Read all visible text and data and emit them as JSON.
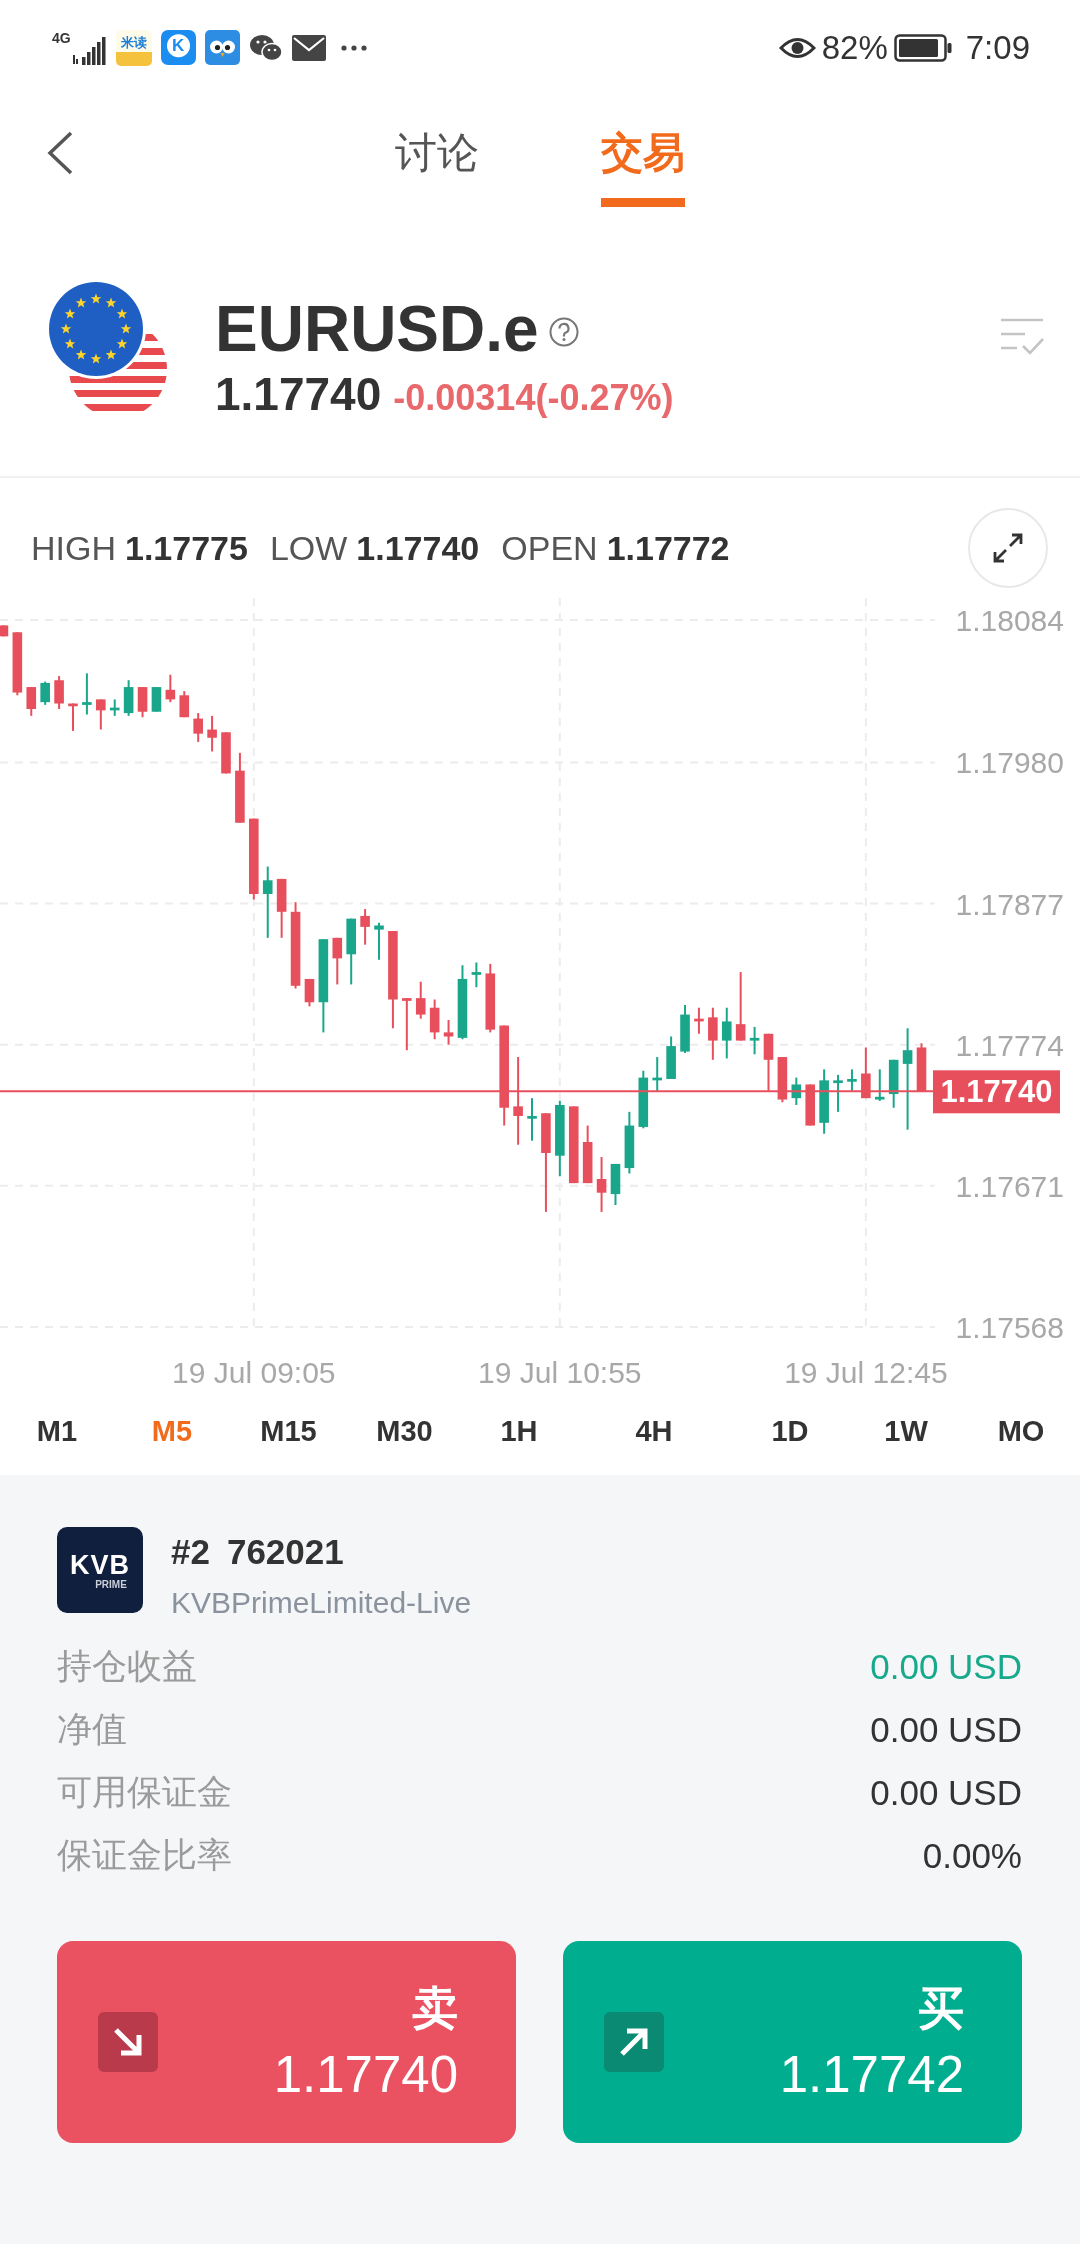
{
  "status_bar": {
    "network": "4G",
    "notifications": [
      {
        "kind": "text_app",
        "label": "米读"
      },
      {
        "kind": "letter_app",
        "label": "K"
      },
      {
        "kind": "owl_app"
      },
      {
        "kind": "chat"
      },
      {
        "kind": "mail"
      }
    ],
    "battery": "82%",
    "time": "7:09"
  },
  "header": {
    "tabs": [
      {
        "label": "讨论",
        "selected": false
      },
      {
        "label": "交易",
        "selected": true
      }
    ]
  },
  "instrument": {
    "symbol": "EURUSD.e",
    "price": "1.17740",
    "change": "-0.00314(-0.27%)"
  },
  "chart": {
    "stats": [
      {
        "label": "HIGH",
        "value": "1.17775"
      },
      {
        "label": "LOW",
        "value": "1.17740"
      },
      {
        "label": "OPEN",
        "value": "1.17772"
      }
    ],
    "chart_data": {
      "type": "candlestick",
      "categories": [
        null,
        null,
        null,
        null,
        null,
        null,
        null,
        null,
        null,
        null,
        null,
        null,
        null,
        null,
        null,
        null,
        null,
        null,
        "19 Jul 09:05",
        null,
        null,
        null,
        null,
        null,
        null,
        null,
        null,
        null,
        null,
        null,
        null,
        null,
        null,
        null,
        null,
        null,
        null,
        null,
        null,
        null,
        "19 Jul 10:55",
        null,
        null,
        null,
        null,
        null,
        null,
        null,
        null,
        null,
        null,
        null,
        null,
        null,
        null,
        null,
        null,
        null,
        null,
        null,
        null,
        null,
        "19 Jul 12:45",
        null,
        null,
        null,
        null
      ],
      "ohlc": [
        [
          1.1808,
          1.1808,
          1.18072,
          1.18072
        ],
        [
          1.18075,
          1.18075,
          1.18029,
          1.18031
        ],
        [
          1.18035,
          1.18035,
          1.18014,
          1.18019
        ],
        [
          1.18024,
          1.18039,
          1.18022,
          1.18038
        ],
        [
          1.1804,
          1.18043,
          1.18019,
          1.18023
        ],
        [
          1.18023,
          1.18023,
          1.18003,
          1.18021
        ],
        [
          1.18022,
          1.18045,
          1.18015,
          1.18024
        ],
        [
          1.18026,
          1.18026,
          1.18004,
          1.18018
        ],
        [
          1.18018,
          1.18026,
          1.18014,
          1.1802
        ],
        [
          1.18016,
          1.1804,
          1.18014,
          1.18035
        ],
        [
          1.18035,
          1.18035,
          1.18013,
          1.18017
        ],
        [
          1.18017,
          1.18035,
          1.18017,
          1.18035
        ],
        [
          1.18033,
          1.18044,
          1.18024,
          1.18026
        ],
        [
          1.18029,
          1.18032,
          1.18013,
          1.18013
        ],
        [
          1.18012,
          1.18016,
          1.17995,
          1.18001
        ],
        [
          1.18004,
          1.18014,
          1.17988,
          1.17998
        ],
        [
          1.18002,
          1.18002,
          1.17972,
          1.17972
        ],
        [
          1.17974,
          1.17987,
          1.17936,
          1.17936
        ],
        [
          1.17939,
          1.17939,
          1.1788,
          1.17884
        ],
        [
          1.17884,
          1.17904,
          1.17852,
          1.17894
        ],
        [
          1.17895,
          1.17895,
          1.17852,
          1.17871
        ],
        [
          1.17871,
          1.17878,
          1.17815,
          1.17817
        ],
        [
          1.17822,
          1.17822,
          1.17802,
          1.17805
        ],
        [
          1.17805,
          1.17851,
          1.17783,
          1.17851
        ],
        [
          1.17852,
          1.17852,
          1.17818,
          1.17837
        ],
        [
          1.1784,
          1.17866,
          1.17818,
          1.17866
        ],
        [
          1.17868,
          1.17873,
          1.17847,
          1.1786
        ],
        [
          1.17858,
          1.17863,
          1.17836,
          1.17861
        ],
        [
          1.17857,
          1.17857,
          1.17786,
          1.17807
        ],
        [
          1.17808,
          1.17808,
          1.1777,
          1.17806
        ],
        [
          1.17808,
          1.1782,
          1.17793,
          1.17796
        ],
        [
          1.17801,
          1.17807,
          1.17778,
          1.17783
        ],
        [
          1.17783,
          1.17792,
          1.17774,
          1.1778
        ],
        [
          1.17779,
          1.17832,
          1.17778,
          1.17822
        ],
        [
          1.17825,
          1.17834,
          1.17816,
          1.17827
        ],
        [
          1.17826,
          1.17833,
          1.17783,
          1.17785
        ],
        [
          1.17788,
          1.17788,
          1.17715,
          1.17728
        ],
        [
          1.17729,
          1.17765,
          1.17701,
          1.17722
        ],
        [
          1.1772,
          1.17735,
          1.17704,
          1.17722
        ],
        [
          1.17724,
          1.17724,
          1.17652,
          1.17695
        ],
        [
          1.17693,
          1.17733,
          1.17678,
          1.1773
        ],
        [
          1.17729,
          1.17729,
          1.17673,
          1.17673
        ],
        [
          1.17703,
          1.17715,
          1.17673,
          1.17673
        ],
        [
          1.17676,
          1.17692,
          1.17652,
          1.17666
        ],
        [
          1.17665,
          1.17687,
          1.17657,
          1.17687
        ],
        [
          1.17684,
          1.17725,
          1.1768,
          1.17715
        ],
        [
          1.17714,
          1.17755,
          1.17713,
          1.1775
        ],
        [
          1.17748,
          1.17765,
          1.1774,
          1.1775
        ],
        [
          1.17749,
          1.1778,
          1.17749,
          1.17773
        ],
        [
          1.17769,
          1.17803,
          1.17768,
          1.17796
        ],
        [
          1.17793,
          1.17801,
          1.17782,
          1.17791
        ],
        [
          1.17794,
          1.17801,
          1.17763,
          1.17777
        ],
        [
          1.17777,
          1.17801,
          1.17764,
          1.17791
        ],
        [
          1.17789,
          1.17827,
          1.17777,
          1.17777
        ],
        [
          1.17777,
          1.17787,
          1.17767,
          1.17779
        ],
        [
          1.17782,
          1.17782,
          1.1774,
          1.17763
        ],
        [
          1.17765,
          1.17765,
          1.17732,
          1.17734
        ],
        [
          1.17735,
          1.1775,
          1.1773,
          1.17745
        ],
        [
          1.17745,
          1.17745,
          1.17715,
          1.17715
        ],
        [
          1.17717,
          1.17756,
          1.17709,
          1.17748
        ],
        [
          1.17746,
          1.17752,
          1.17725,
          1.17748
        ],
        [
          1.17747,
          1.17756,
          1.1774,
          1.17749
        ],
        [
          1.17753,
          1.17772,
          1.17735,
          1.17735
        ],
        [
          1.17734,
          1.17756,
          1.17733,
          1.17736
        ],
        [
          1.17738,
          1.17763,
          1.17728,
          1.17763
        ],
        [
          1.1776,
          1.17786,
          1.17712,
          1.1777
        ],
        [
          1.17772,
          1.17775,
          1.1774,
          1.1774
        ]
      ],
      "ylim": [
        1.17568,
        1.181
      ],
      "yticks": [
        {
          "value": 1.18084,
          "label": "1.18084"
        },
        {
          "value": 1.1798,
          "label": "1.17980"
        },
        {
          "value": 1.17877,
          "label": "1.17877"
        },
        {
          "value": 1.17774,
          "label": "1.17774"
        },
        {
          "value": 1.17671,
          "label": "1.17671"
        },
        {
          "value": 1.17568,
          "label": "1.17568"
        }
      ],
      "grid": true,
      "ref_lines": [
        {
          "axis": "y",
          "value": 1.1774,
          "label": "1.17740"
        }
      ]
    }
  },
  "timeframes": [
    {
      "label": "M1",
      "selected": false
    },
    {
      "label": "M5",
      "selected": true
    },
    {
      "label": "M15",
      "selected": false
    },
    {
      "label": "M30",
      "selected": false
    },
    {
      "label": "1H",
      "selected": false
    },
    {
      "label": "4H",
      "selected": false
    },
    {
      "label": "1D",
      "selected": false
    },
    {
      "label": "1W",
      "selected": false
    },
    {
      "label": "MO",
      "selected": false
    }
  ],
  "account": {
    "logo": {
      "text": "KVB",
      "subtext": "PRIME"
    },
    "index": "#2",
    "login": "762021",
    "server": "KVBPrimeLimited-Live",
    "rows": [
      {
        "label": "持仓收益",
        "value": "0.00 USD",
        "kind": "profit"
      },
      {
        "label": "净值",
        "value": "0.00 USD",
        "kind": "plain"
      },
      {
        "label": "可用保证金",
        "value": "0.00 USD",
        "kind": "plain"
      },
      {
        "label": "保证金比率",
        "value": "0.00%",
        "kind": "plain"
      }
    ]
  },
  "trade_buttons": [
    {
      "kind": "sell",
      "label": "卖",
      "price": "1.17740"
    },
    {
      "kind": "buy",
      "label": "买",
      "price": "1.17742"
    }
  ]
}
